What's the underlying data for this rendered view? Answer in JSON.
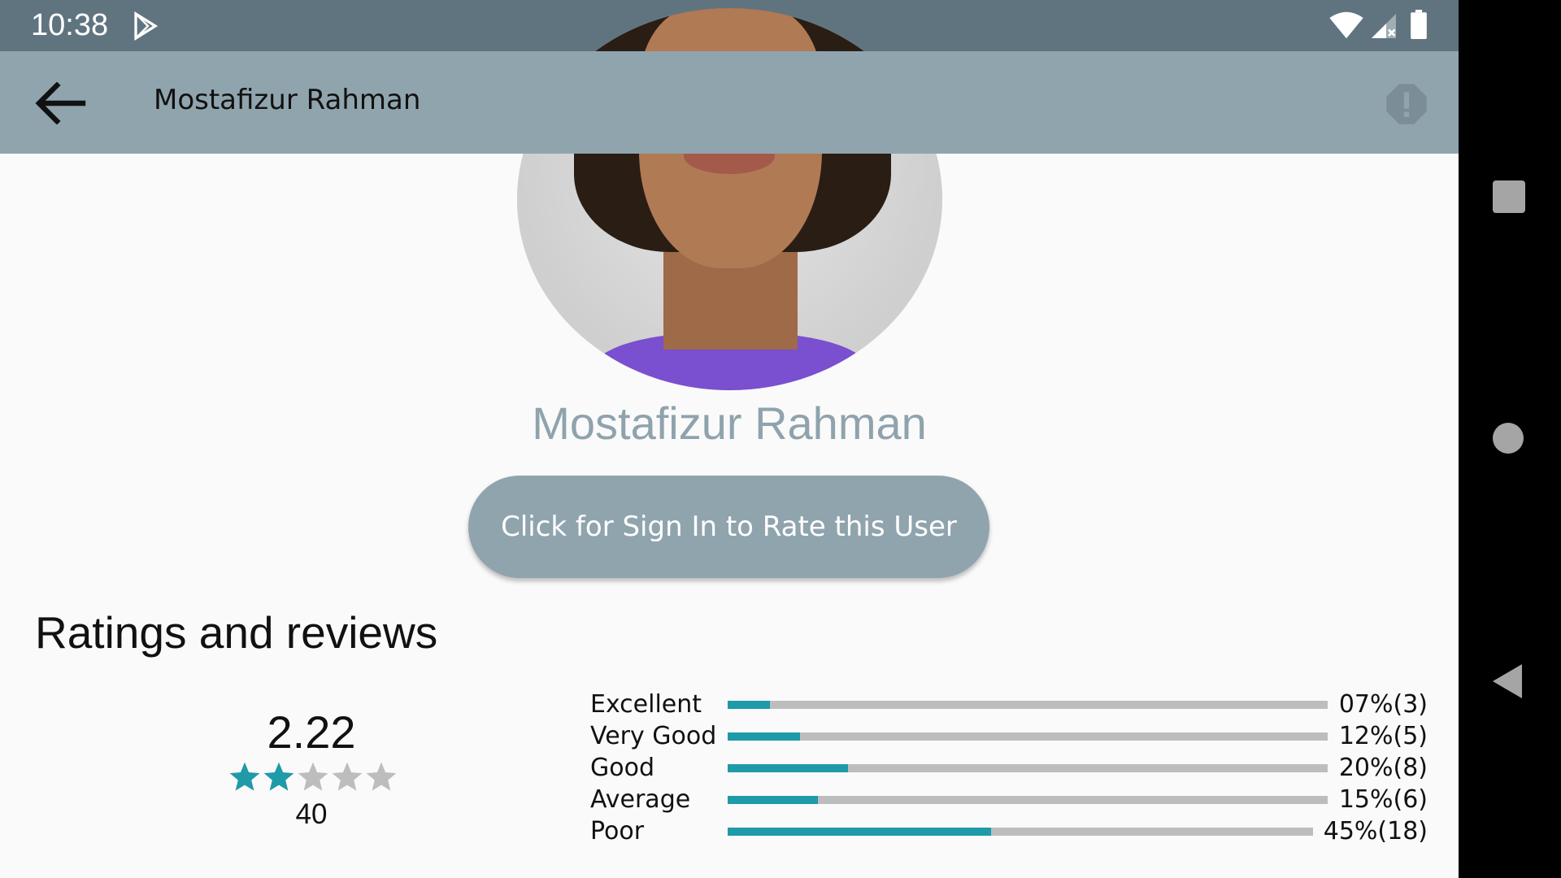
{
  "status_bar": {
    "time": "10:38",
    "icons": [
      "play-store-icon",
      "wifi-icon",
      "signal-icon",
      "battery-icon"
    ]
  },
  "app_bar": {
    "title": "Mostafizur Rahman",
    "back_icon": "arrow-back-icon",
    "report_icon": "report-icon"
  },
  "profile": {
    "name": "Mostafizur Rahman",
    "signin_button": "Click for Sign In to Rate this User"
  },
  "ratings": {
    "section_title": "Ratings and reviews",
    "average": "2.22",
    "stars_filled": 2,
    "stars_total": 5,
    "count": "40",
    "distribution": [
      {
        "label": "Excellent",
        "percent": 7,
        "value": "07%(3)"
      },
      {
        "label": "Very Good",
        "percent": 12,
        "value": "12%(5)"
      },
      {
        "label": "Good",
        "percent": 20,
        "value": "20%(8)"
      },
      {
        "label": "Average",
        "percent": 15,
        "value": "15%(6)"
      },
      {
        "label": "Poor",
        "percent": 45,
        "value": "45%(18)"
      }
    ]
  },
  "colors": {
    "status_bar": "#607480",
    "app_bar": "#90a4ae",
    "accent": "#1e9aa8",
    "track": "#bdbdbd",
    "name_text": "#8fa3ad"
  },
  "nav_bar": {
    "icons": [
      "recents-icon",
      "home-icon",
      "back-icon"
    ]
  }
}
